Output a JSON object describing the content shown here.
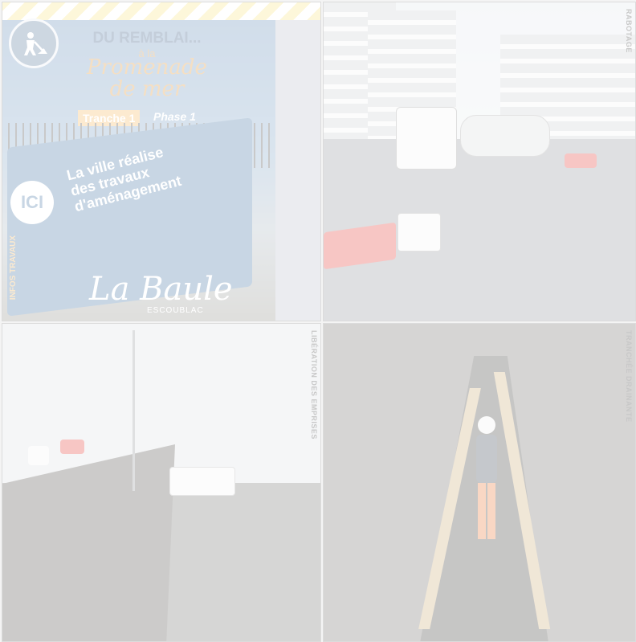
{
  "tiles": [
    {
      "poster": {
        "title": "DU REMBLAI...",
        "subtitle": "à la",
        "promenade_line1": "Promenade",
        "promenade_line2": "de mer",
        "tranche": "Tranche 1",
        "phase": "Phase 1",
        "badge": "ICI",
        "sign_line1": "La ville réalise",
        "sign_line2": "des travaux",
        "sign_line3": "d'aménagement",
        "side_label": "INFOS TRAVAUX",
        "logo": "La Baule",
        "logo_sub": "ESCOUBLAC"
      }
    },
    {
      "caption": "RABOTAGE"
    },
    {
      "caption": "LIBÉRATION DES EMPRISES"
    },
    {
      "caption": "TRANCHÉE DRAINANTE"
    }
  ],
  "colors": {
    "poster_blue": "#3b6e9e",
    "accent_orange": "#f2b257",
    "hazard_yellow": "#f6e27a",
    "barrier_red": "#e0342e"
  }
}
